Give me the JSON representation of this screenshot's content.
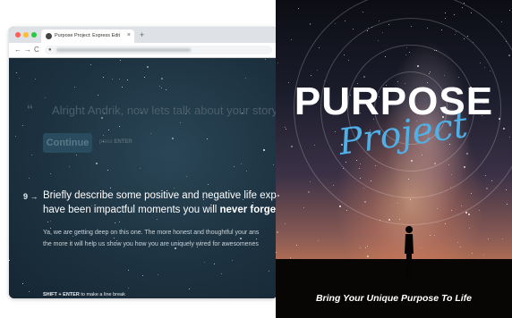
{
  "browser": {
    "tab_title": "Purpose Project: Express Edit",
    "tab_close": "×",
    "new_tab": "+",
    "nav_back": "←",
    "nav_forward": "→",
    "nav_reload": "C",
    "lock_icon": "🔒"
  },
  "form": {
    "quote_mark": "“",
    "previous_question": "Alright Andrik, now lets talk about your story!",
    "continue_label": "Continue",
    "press_hint_prefix": "press ",
    "press_hint_key": "ENTER",
    "question_number": "9",
    "question_arrow": "→",
    "question_line1": "Briefly describe some positive and negative life experien",
    "question_line2_prefix": "have been impactful moments you will ",
    "question_line2_bold": "never forget.",
    "subtext_line1": "Ya, we are getting deep on this one. The more honest and thoughtful your ans",
    "subtext_line2": "the more it will help us show you how you are uniquely wired for awesomenes",
    "line_break_keys": "SHIFT + ENTER",
    "line_break_suffix": " to make a line break"
  },
  "cover": {
    "title": "PURPOSE",
    "subtitle": "Project",
    "tagline": "Bring Your Unique Purpose To Life"
  },
  "colors": {
    "window_bg": "#1f3544",
    "subtitle_blue": "#4fb0e8"
  }
}
